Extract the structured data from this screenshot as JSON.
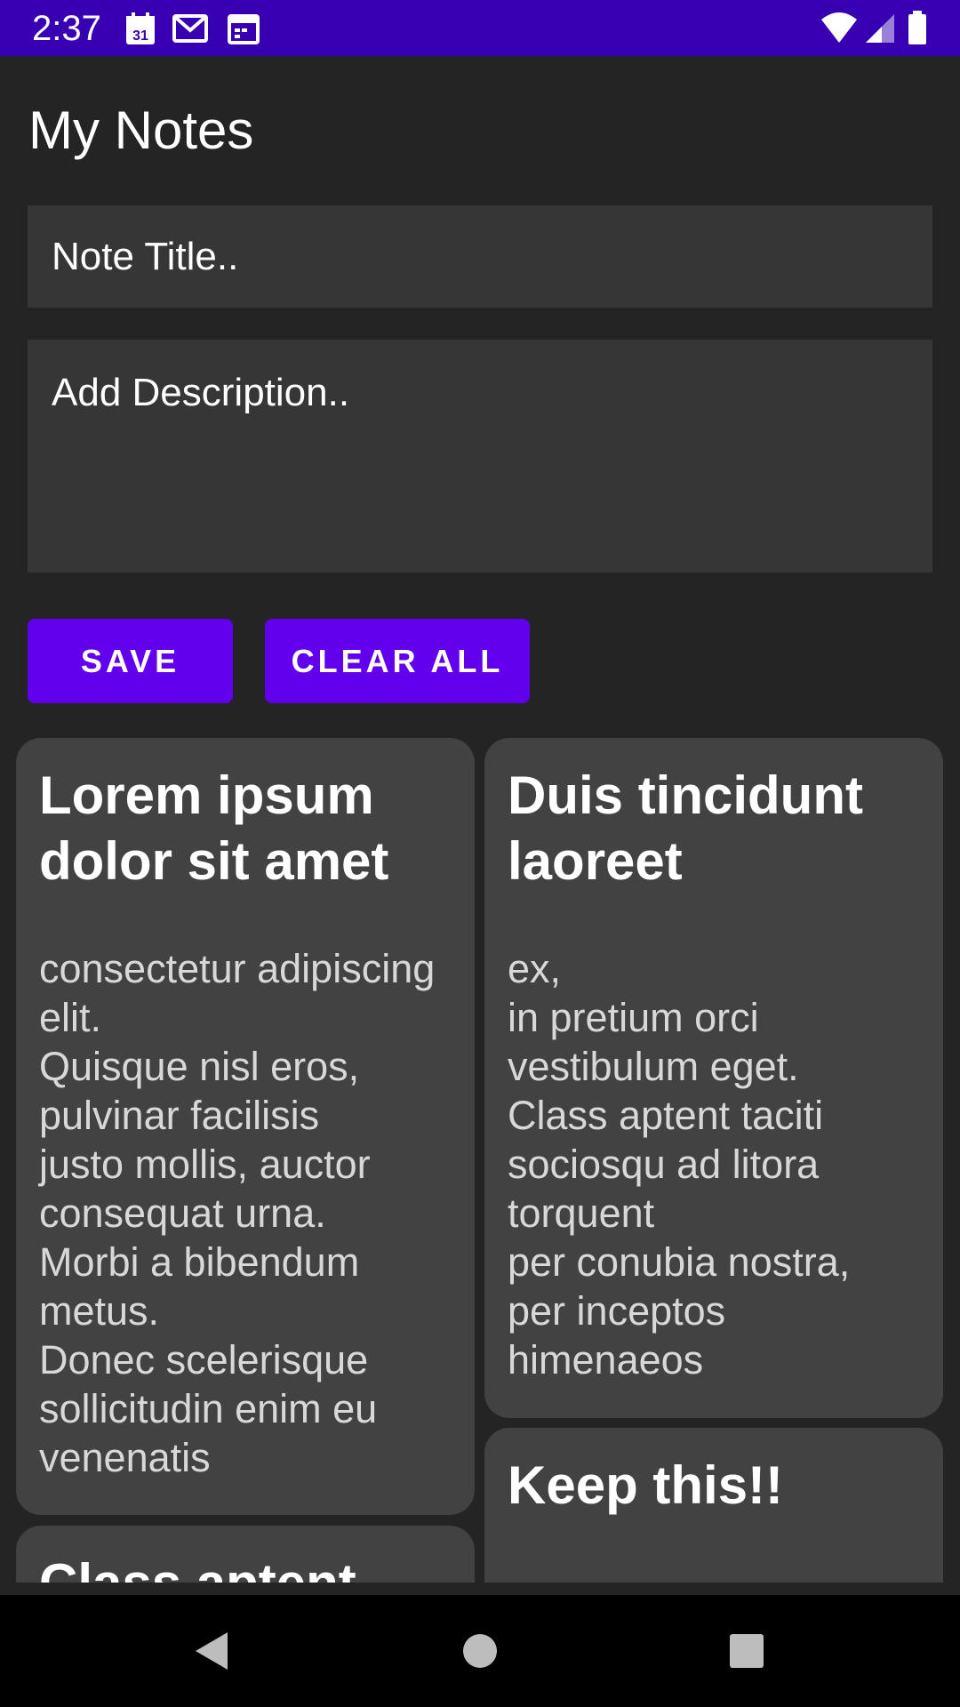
{
  "status_bar": {
    "time": "2:37",
    "icons": [
      "calendar-icon",
      "gmail-icon",
      "calendar-schedule-icon",
      "wifi-icon",
      "signal-icon",
      "battery-icon"
    ],
    "calendar_day": "31",
    "background": "#3700b3"
  },
  "app": {
    "title": "My Notes"
  },
  "form": {
    "title_placeholder": "Note Title..",
    "description_placeholder": "Add Description..",
    "save_label": "SAVE",
    "clear_label": "CLEAR ALL",
    "button_color": "#6200ee"
  },
  "notes": [
    {
      "title": "Lorem ipsum dolor sit amet",
      "description": " consectetur adipiscing elit.\nQuisque nisl eros,\npulvinar facilisis\njusto mollis, auctor\nconsequat urna.\nMorbi a bibendum\nmetus.\nDonec scelerisque\nsollicitudin enim eu\nvenenatis"
    },
    {
      "title": "Duis tincidunt laoreet",
      "description": "ex,\nin pretium orci\nvestibulum eget.\nClass aptent taciti\nsociosqu ad litora\ntorquent\nper conubia nostra,\nper inceptos\nhimenaeos"
    },
    {
      "title": "Keep this!!",
      "description": ""
    },
    {
      "title": "Class aptent",
      "description": ""
    }
  ],
  "nav_bar": {
    "icons": [
      "back-icon",
      "home-icon",
      "recents-icon"
    ]
  }
}
